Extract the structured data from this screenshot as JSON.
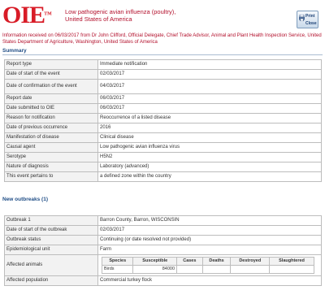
{
  "header": {
    "title_line1": "Low pathogenic avian influenza (poultry),",
    "title_line2": "United States of America",
    "print_label_1": "Print",
    "print_label_2": "Close"
  },
  "info_text": "Information received on 06/03/2017 from Dr John Clifford, Official Delegate, Chief Trade Advisor, Animal and Plant Health Inspection Service, United States Department of Agriculture, Washington, United States of America",
  "summary": {
    "title": "Summary",
    "rows": [
      {
        "key": "Report type",
        "value": "Immediate notification"
      },
      {
        "key": "Date of start of the event",
        "value": "02/03/2017"
      },
      {
        "key": "Date of confirmation of the event",
        "value": "04/03/2017"
      },
      {
        "key": "Report date",
        "value": "06/03/2017"
      },
      {
        "key": "Date submitted to OIE",
        "value": "06/03/2017"
      },
      {
        "key": "Reason for notification",
        "value": "Reoccurrence of a listed disease"
      },
      {
        "key": "Date of previous occurrence",
        "value": "2016"
      },
      {
        "key": "Manifestation of disease",
        "value": "Clinical disease"
      },
      {
        "key": "Causal agent",
        "value": "Low pathogenic avian influenza virus"
      },
      {
        "key": "Serotype",
        "value": "H5N2"
      },
      {
        "key": "Nature of diagnosis",
        "value": "Laboratory (advanced)"
      },
      {
        "key": "This event pertains to",
        "value": "a defined zone within the country"
      }
    ]
  },
  "new_outbreaks": {
    "title": "New outbreaks (1)",
    "rows": [
      {
        "key": "Outbreak 1",
        "value": "Barron County, Barron, WISCONSIN"
      },
      {
        "key": "Date of start of the outbreak",
        "value": "02/03/2017"
      },
      {
        "key": "Outbreak status",
        "value": "Continuing (or date resolved not provided)"
      },
      {
        "key": "Epidemiological unit",
        "value": "Farm"
      }
    ],
    "affected_animals_label": "Affected animals",
    "species_headers": [
      "Species",
      "Susceptible",
      "Cases",
      "Deaths",
      "Destroyed",
      "Slaughtered"
    ],
    "species_rows": [
      [
        "Birds",
        "84000",
        "",
        "",
        "",
        ""
      ]
    ],
    "affected_population_label": "Affected population",
    "affected_population_value": "Commercial turkey flock"
  }
}
